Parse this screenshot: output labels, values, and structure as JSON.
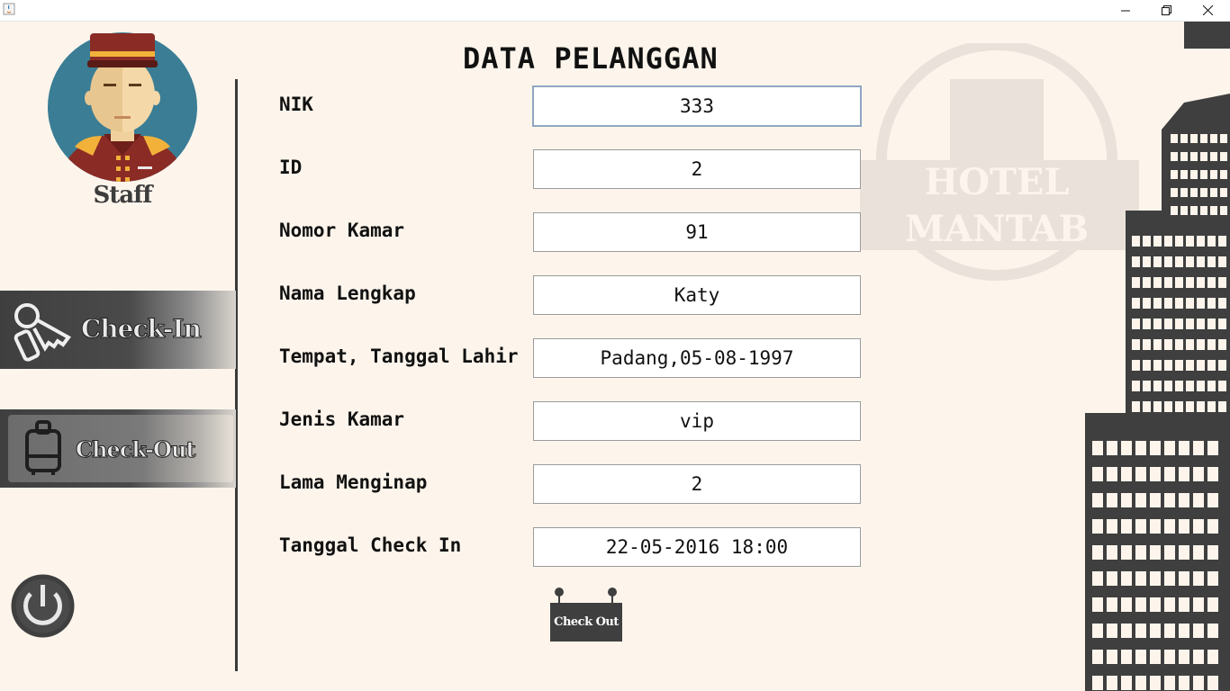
{
  "window": {
    "minimize_icon": "minimize-icon",
    "restore_icon": "restore-icon",
    "close_icon": "close-icon"
  },
  "sidebar": {
    "staff_label": "Staff",
    "nav": [
      {
        "label": "Check-In",
        "icon": "keys-icon"
      },
      {
        "label": "Check-Out",
        "icon": "luggage-icon"
      }
    ],
    "power_icon": "power-icon"
  },
  "form": {
    "title": "DATA PELANGGAN",
    "fields": [
      {
        "label": "NIK",
        "value": "333"
      },
      {
        "label": "ID",
        "value": "2"
      },
      {
        "label": "Nomor Kamar",
        "value": "91"
      },
      {
        "label": "Nama Lengkap",
        "value": "Katy"
      },
      {
        "label": "Tempat, Tanggal Lahir",
        "value": "Padang,05-08-1997"
      },
      {
        "label": "Jenis Kamar",
        "value": "vip"
      },
      {
        "label": "Lama Menginap",
        "value": "2"
      },
      {
        "label": "Tanggal Check In",
        "value": "22-05-2016 18:00"
      }
    ],
    "submit_label": "Check Out"
  },
  "watermark": {
    "line1": "HOTEL",
    "line2": "MANTAB"
  },
  "colors": {
    "background": "#fdf5ec",
    "nav_dark": "#3f3f3f",
    "focus_border": "#8fa6c2",
    "building": "#3f3f3f"
  }
}
